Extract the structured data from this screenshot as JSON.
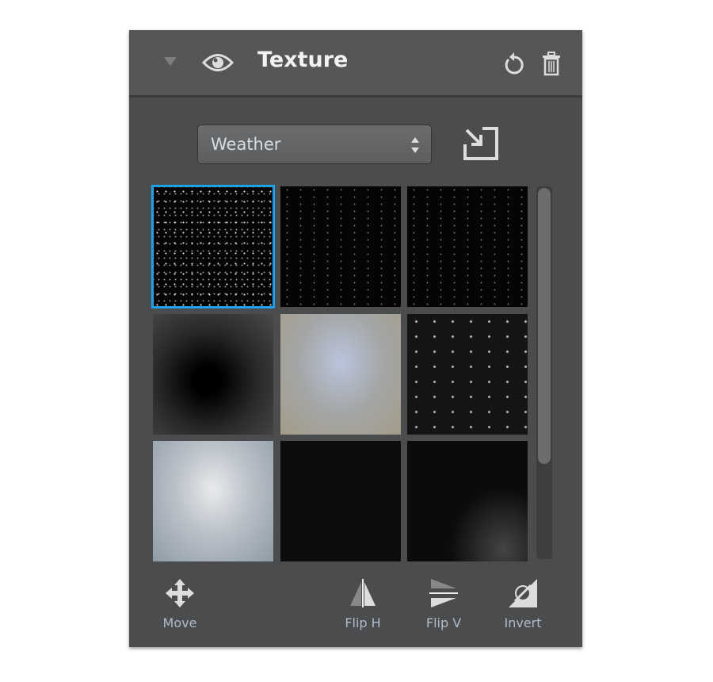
{
  "header": {
    "title": "Texture",
    "collapse_icon": "triangle-down-icon",
    "visibility_icon": "eye-icon",
    "reset_icon": "reset-icon",
    "delete_icon": "trash-icon"
  },
  "category": {
    "selected": "Weather",
    "import_icon": "import-arrow-icon"
  },
  "thumbnails": [
    {
      "style": "stars",
      "selected": true
    },
    {
      "style": "stars2",
      "selected": false
    },
    {
      "style": "stars2",
      "selected": false
    },
    {
      "style": "vign",
      "selected": false
    },
    {
      "style": "frost",
      "selected": false
    },
    {
      "style": "bokeh",
      "selected": false
    },
    {
      "style": "sky",
      "selected": false
    },
    {
      "style": "dark",
      "selected": false
    },
    {
      "style": "dark2",
      "selected": false
    }
  ],
  "accent": "#1ea1ea",
  "tools": [
    {
      "label": "Move",
      "icon": "move-icon"
    },
    {
      "label": "Flip H",
      "icon": "flip-horizontal-icon"
    },
    {
      "label": "Flip V",
      "icon": "flip-vertical-icon"
    },
    {
      "label": "Invert",
      "icon": "invert-icon"
    }
  ]
}
